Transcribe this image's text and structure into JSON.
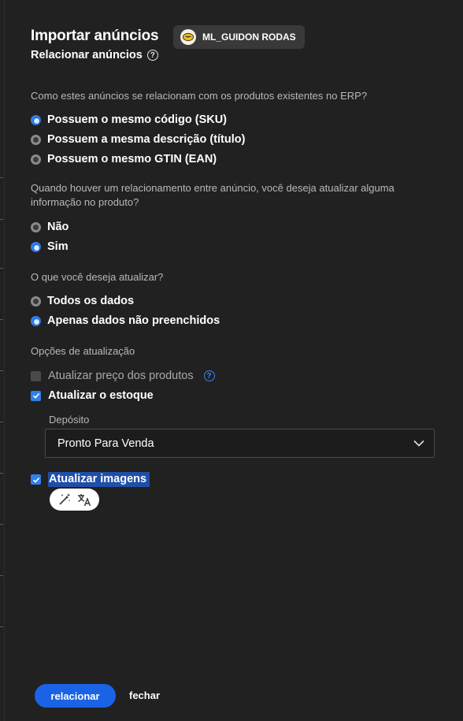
{
  "header": {
    "title": "Importar anúncios",
    "account_chip": "ML_GUIDON RODAS",
    "subtitle": "Relacionar anúncios"
  },
  "relation": {
    "question": "Como estes anúncios se relacionam com os produtos existentes no ERP?",
    "options": [
      {
        "label": "Possuem o mesmo código (SKU)",
        "selected": true
      },
      {
        "label": "Possuem a mesma descrição (título)",
        "selected": false
      },
      {
        "label": "Possuem o mesmo GTIN (EAN)",
        "selected": false
      }
    ]
  },
  "update_question": {
    "question": "Quando houver um relacionamento entre anúncio, você deseja atualizar alguma informação no produto?",
    "options": [
      {
        "label": "Não",
        "selected": false
      },
      {
        "label": "Sim",
        "selected": true
      }
    ]
  },
  "what_update": {
    "question": "O que você deseja atualizar?",
    "options": [
      {
        "label": "Todos os dados",
        "selected": false
      },
      {
        "label": "Apenas dados não preenchidos",
        "selected": true
      }
    ]
  },
  "update_options": {
    "label": "Opções de atualização",
    "items": [
      {
        "label": "Atualizar preço dos produtos",
        "checked": false
      },
      {
        "label": "Atualizar o estoque",
        "checked": true
      },
      {
        "label": "Atualizar imagens",
        "checked": true
      }
    ]
  },
  "deposit": {
    "label": "Depósito",
    "selected_value": "Pronto Para Venda"
  },
  "footer": {
    "primary_label": "relacionar",
    "secondary_label": "fechar"
  },
  "colors": {
    "background": "#212121",
    "accent": "#1a63e6",
    "selection": "#1f4fa8"
  },
  "icons": [
    "help-icon",
    "chevron-down-icon",
    "check-icon",
    "magic-wand-icon",
    "translate-icon",
    "account-avatar-icon"
  ]
}
